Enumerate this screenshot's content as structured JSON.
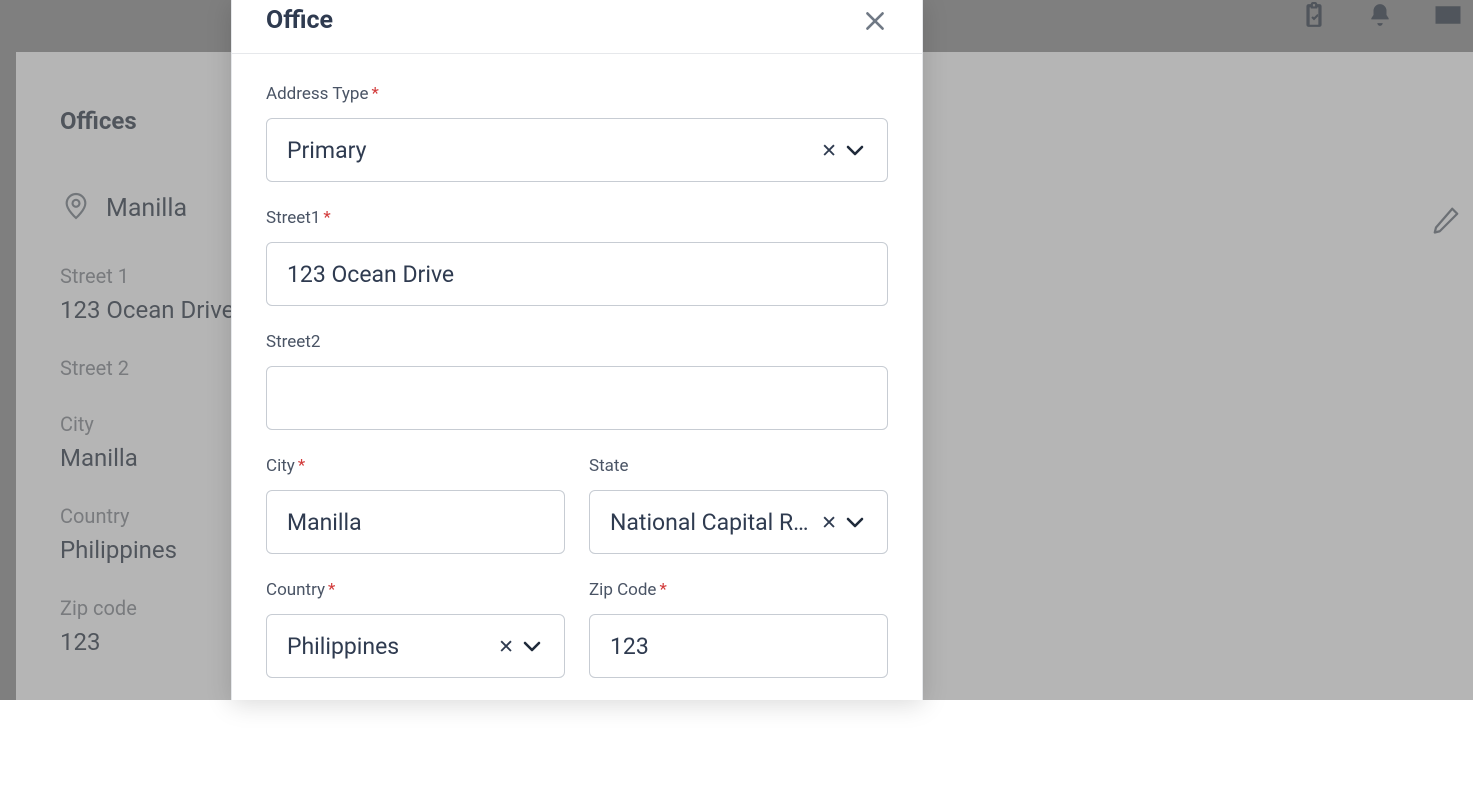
{
  "header": {
    "title": "Offices"
  },
  "office": {
    "name": "Manilla",
    "fields": {
      "street1_label": "Street 1",
      "street1_value": "123 Ocean Drive",
      "street2_label": "Street 2",
      "street2_value": "",
      "city_label": "City",
      "city_value": "Manilla",
      "country_label": "Country",
      "country_value": "Philippines",
      "zip_label": "Zip code",
      "zip_value": "123"
    }
  },
  "modal": {
    "title": "Office",
    "labels": {
      "address_type": "Address Type",
      "street1": "Street1",
      "street2": "Street2",
      "city": "City",
      "state": "State",
      "country": "Country",
      "zip": "Zip Code"
    },
    "values": {
      "address_type": "Primary",
      "street1": "123 Ocean Drive",
      "street2": "",
      "city": "Manilla",
      "state": "National Capital Reg...",
      "country": "Philippines",
      "zip": "123"
    }
  }
}
